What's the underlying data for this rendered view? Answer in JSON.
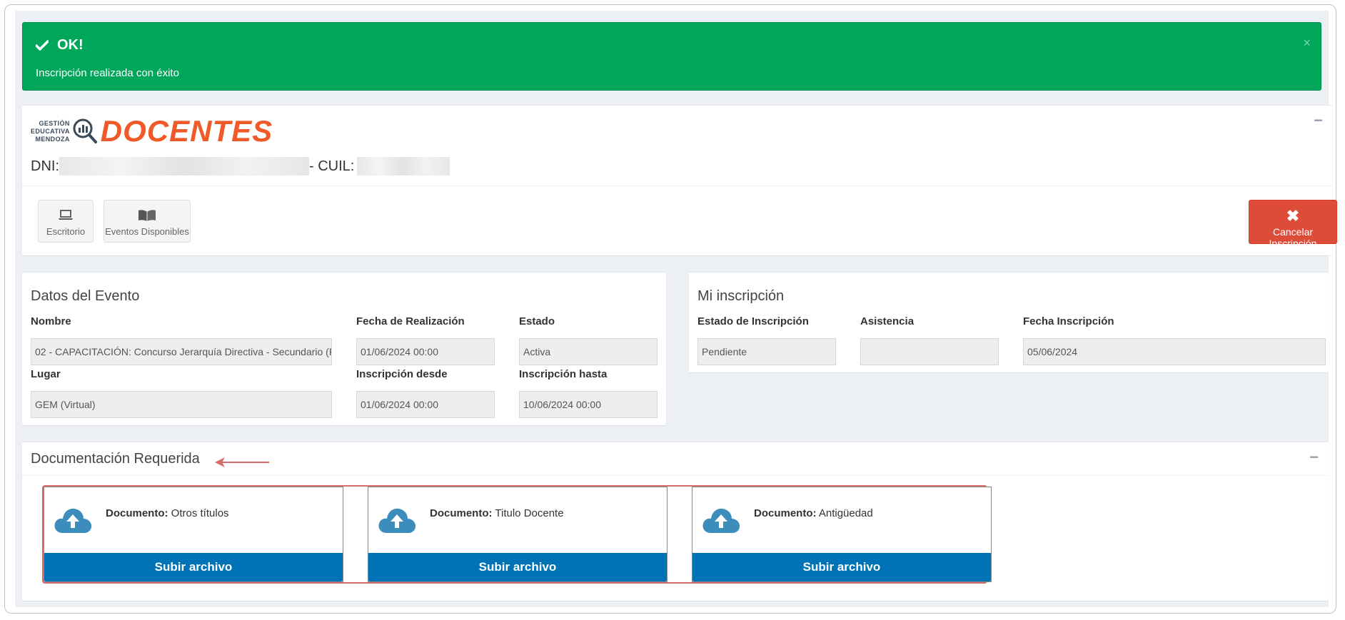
{
  "alert": {
    "title": "OK!",
    "message": "Inscripción realizada con éxito",
    "close": "×",
    "color": "#00a65a"
  },
  "header": {
    "logo_top": [
      "GESTIÓN",
      "EDUCATIVA",
      "MENDOZA"
    ],
    "logo_brand": "DOCENTES",
    "dni_label": "DNI:",
    "cuil_label": "- CUIL:",
    "collapse": "−"
  },
  "toolbar": {
    "escritorio_label": "Escritorio",
    "eventos_label": "Eventos Disponibles",
    "cancel_label": "Cancelar Inscripción",
    "cancel_color": "#dd4b39"
  },
  "evento": {
    "title": "Datos del Evento",
    "nombre_label": "Nombre",
    "nombre_value": "02 - CAPACITACIÓN: Concurso Jerarquía Directiva - Secundario (F",
    "fecha_label": "Fecha de Realización",
    "fecha_value": "01/06/2024 00:00",
    "estado_label": "Estado",
    "estado_value": "Activa",
    "lugar_label": "Lugar",
    "lugar_value": "GEM (Virtual)",
    "desde_label": "Inscripción desde",
    "desde_value": "01/06/2024 00:00",
    "hasta_label": "Inscripción hasta",
    "hasta_value": "10/06/2024 00:00"
  },
  "inscripcion": {
    "title": "Mi inscripción",
    "estado_label": "Estado de Inscripción",
    "estado_value": "Pendiente",
    "asistencia_label": "Asistencia",
    "asistencia_value": "",
    "fecha_label": "Fecha Inscripción",
    "fecha_value": "05/06/2024"
  },
  "docs": {
    "title": "Documentación Requerida",
    "collapse": "−",
    "doc_prefix": "Documento:",
    "upload_label": "Subir archivo",
    "items": [
      {
        "name": "Otros títulos"
      },
      {
        "name": "Titulo Docente"
      },
      {
        "name": "Antigüedad"
      }
    ],
    "upload_color": "#0073b7"
  }
}
